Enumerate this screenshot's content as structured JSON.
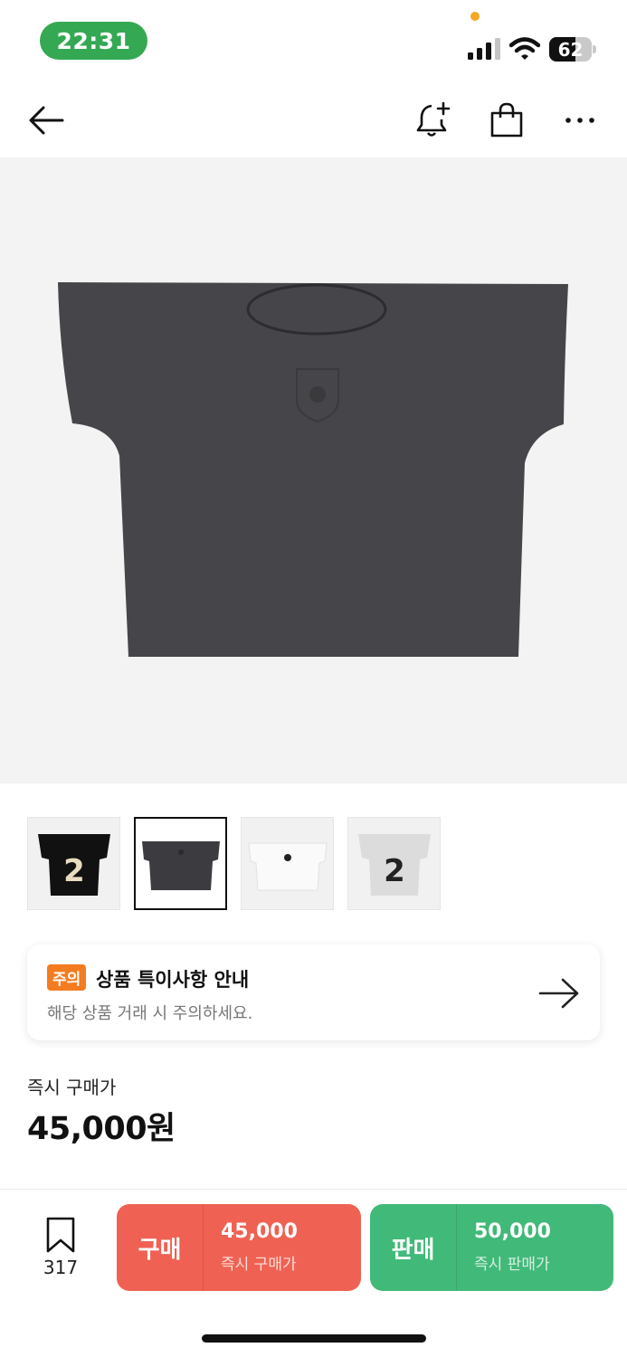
{
  "status_bar": {
    "time": "22:31",
    "battery_level": "62",
    "battery_fraction": 0.62,
    "icons": [
      "signal-icon",
      "wifi-icon",
      "battery-icon"
    ],
    "colors": {
      "time_pill": "#34a853",
      "dot": "#f5a623"
    }
  },
  "nav": {
    "icons": [
      "back-arrow-icon",
      "bell-plus-icon",
      "shopping-bag-icon",
      "more-icon"
    ]
  },
  "product": {
    "image": "tshirt-black-crest",
    "thumbnails": [
      {
        "name": "black-shirt-number-2",
        "number": "2",
        "selected": false
      },
      {
        "name": "charcoal-shirt-crest",
        "selected": true
      },
      {
        "name": "white-shirt-crest",
        "selected": false
      },
      {
        "name": "grey-shirt-number-2",
        "number": "2",
        "selected": false
      }
    ]
  },
  "notice": {
    "badge": "주의",
    "title": "상품 특이사항 안내",
    "subtitle": "해당 상품 거래 시 주의하세요.",
    "icon": "arrow-right-icon",
    "badge_color": "#f47c20"
  },
  "price": {
    "label": "즉시 구매가",
    "value": "45,000원"
  },
  "bottom_bar": {
    "wishlist_count": "317",
    "buy": {
      "label": "구매",
      "price": "45,000",
      "sub": "즉시 구매가",
      "color": "#ef6253"
    },
    "sell": {
      "label": "판매",
      "price": "50,000",
      "sub": "즉시 판매가",
      "color": "#41b979"
    }
  }
}
